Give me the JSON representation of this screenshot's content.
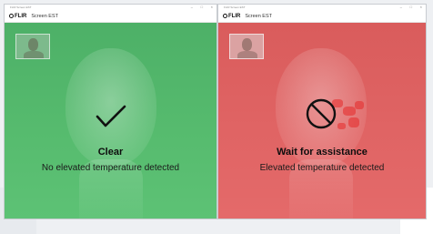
{
  "windows": [
    {
      "titlebar": {
        "title": "FLIR Screen EST",
        "controls": [
          "–",
          "□",
          "×"
        ]
      },
      "app": {
        "brand": "FLIR",
        "name": "Screen EST"
      },
      "state": "clear",
      "status": {
        "headline": "Clear",
        "message": "No elevated temperature detected"
      },
      "status_icon": "checkmark-icon",
      "colors": {
        "background": "#56bb6e"
      }
    },
    {
      "titlebar": {
        "title": "FLIR Screen EST",
        "controls": [
          "–",
          "□",
          "×"
        ]
      },
      "app": {
        "brand": "FLIR",
        "name": "Screen EST"
      },
      "state": "elevated",
      "status": {
        "headline": "Wait for assistance",
        "message": "Elevated temperature detected"
      },
      "status_icon": "prohibited-icon",
      "colors": {
        "background": "#e06464"
      }
    }
  ]
}
